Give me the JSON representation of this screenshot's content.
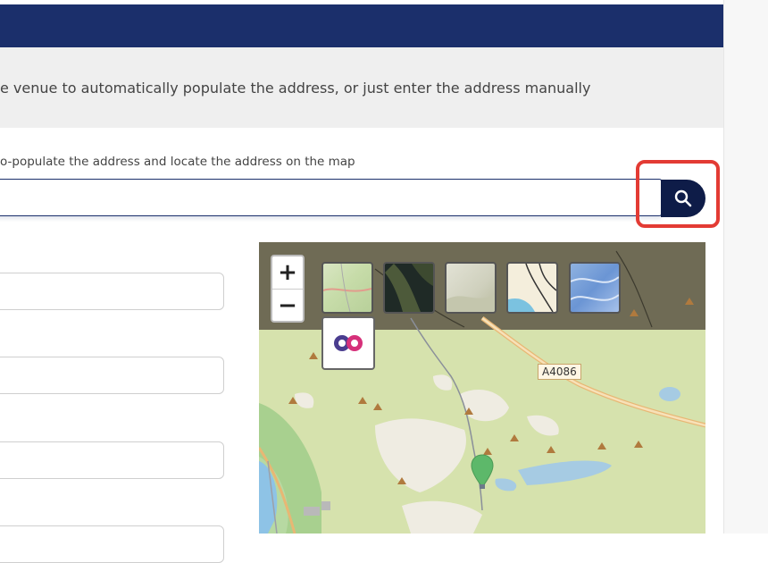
{
  "info_bar": {
    "text": "e venue to automatically populate the address, or just enter the address manually"
  },
  "search": {
    "hint": "o-populate the address and locate the address on the map",
    "value": "",
    "button_icon": "search-icon"
  },
  "map": {
    "zoom_in_label": "+",
    "zoom_out_label": "−",
    "road_label": "A4086",
    "layer_thumbnails": [
      "outdoor-map",
      "satellite",
      "terrain",
      "road-map",
      "relief"
    ],
    "os_logo": "os-logo"
  },
  "colors": {
    "header": "#1b2f6b",
    "search_button": "#0e1c48",
    "highlight": "#e33b34",
    "pin": "#5db86a"
  }
}
